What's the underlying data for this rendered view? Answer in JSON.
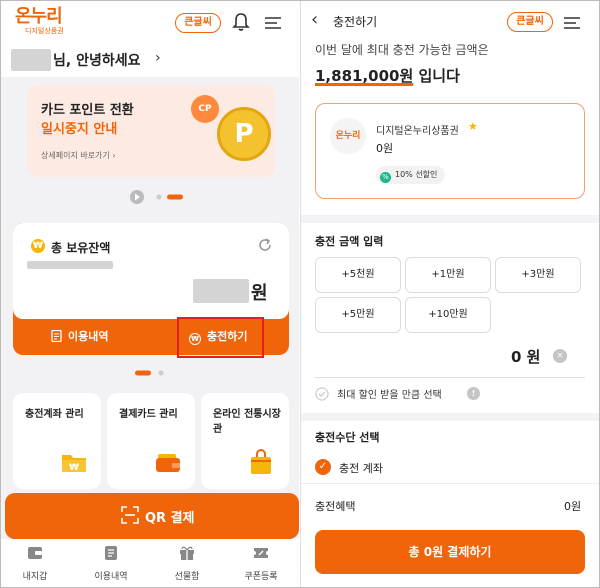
{
  "left": {
    "logo": {
      "main": "온누리",
      "sub": "디지털상품권"
    },
    "header": {
      "bigtext_label": "큰글씨"
    },
    "greeting": {
      "text": "님, 안녕하세요",
      "arrow": "›"
    },
    "banner": {
      "line1": "카드 포인트 전환",
      "line2": "일시중지 안내",
      "link": "상세페이지 바로가기",
      "coin_letter": "P",
      "coin_small": "CP"
    },
    "balance": {
      "title": "총 보유잔액",
      "unit": "원",
      "won_symbol": "₩"
    },
    "card_buttons": {
      "history": "이용내역",
      "charge": "충전하기"
    },
    "tiles": [
      {
        "label": "충전계좌 관리",
        "icon": "folder-won-icon"
      },
      {
        "label": "결제카드 관리",
        "icon": "wallet-card-icon"
      },
      {
        "label": "온라인 전통시장관",
        "icon": "shopping-bag-icon"
      }
    ],
    "qr": {
      "label": "QR 결제"
    },
    "nav": [
      {
        "label": "내지갑",
        "icon": "wallet-icon"
      },
      {
        "label": "이용내역",
        "icon": "document-icon"
      },
      {
        "label": "선물함",
        "icon": "gift-icon"
      },
      {
        "label": "쿠폰등록",
        "icon": "coupon-icon"
      }
    ]
  },
  "right": {
    "header": {
      "title": "충전하기",
      "back": "‹",
      "bigtext_label": "큰글씨"
    },
    "sub": "이번 달에 최대 충전 가능한 금액은",
    "max_amount": "1,881,000원",
    "max_suffix": " 입니다",
    "voucher": {
      "logo": "온누리",
      "name": "디지털온누리상품권",
      "star": "★",
      "value": "0원",
      "badge": "10% 선할인",
      "badge_icon": "%"
    },
    "amount_input": {
      "title": "충전 금액 입력",
      "buttons": [
        "+5천원",
        "+1만원",
        "+3만원",
        "+5만원",
        "+10만원"
      ],
      "display": "0 원",
      "clear": "×"
    },
    "max_discount_check": {
      "label": "최대 할인 받을 만큼 선택",
      "info": "!"
    },
    "method": {
      "title": "충전수단 선택",
      "option": "충전 계좌",
      "check": "✓"
    },
    "benefit": {
      "label": "충전혜택",
      "value": "0원"
    },
    "pay_button": "총 0원 결제하기"
  },
  "colors": {
    "accent": "#f0640a",
    "highlight_box": "#e02020",
    "background": "#f2f2f4"
  }
}
